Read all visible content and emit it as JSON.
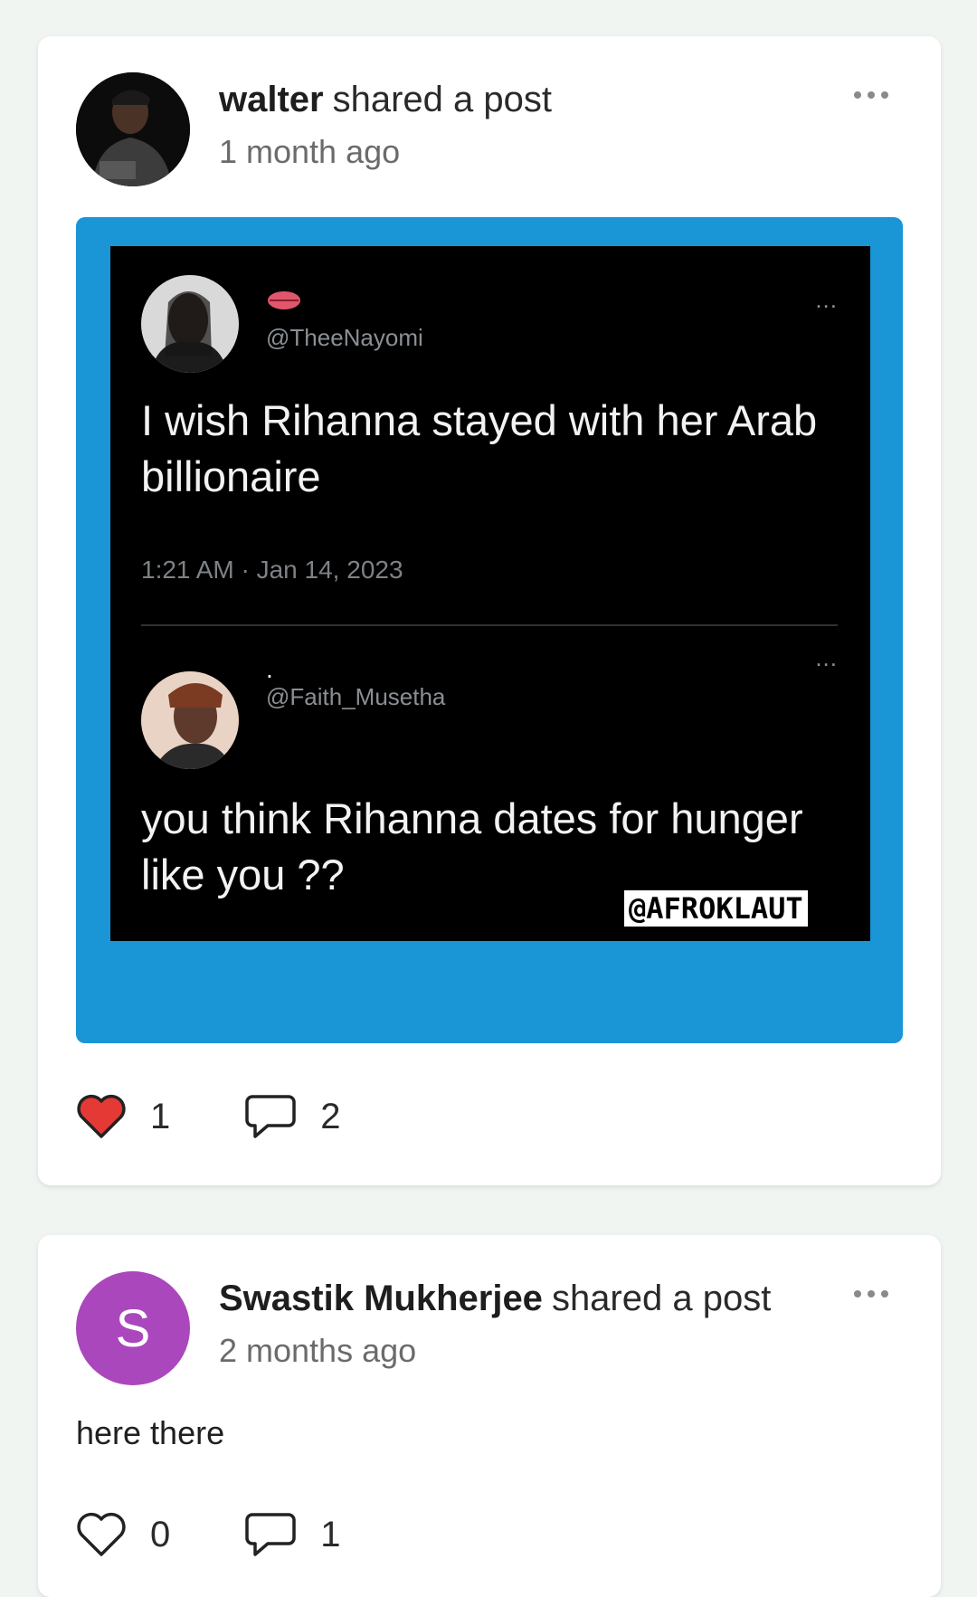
{
  "feed": {
    "posts": [
      {
        "user": "walter",
        "action": "shared a post",
        "time": "1 month ago",
        "media": {
          "tweet1": {
            "handle": "@TheeNayomi",
            "text": "I wish Rihanna stayed with her Arab billionaire",
            "date": "1:21 AM · Jan 14, 2023",
            "more": "..."
          },
          "tweet2": {
            "name": ".",
            "handle": "@Faith_Musetha",
            "text": "you think Rihanna dates for hunger like you ??",
            "more": "..."
          },
          "watermark": "@AFROKLAUT"
        },
        "likes": "1",
        "comments": "2",
        "liked": true
      },
      {
        "user": "Swastik Mukherjee",
        "action": "shared a post",
        "time": "2 months ago",
        "avatar_letter": "S",
        "avatar_color": "#ab47bc",
        "body": "here there",
        "likes": "0",
        "comments": "1",
        "liked": false
      }
    ],
    "icons": {
      "like": "heart-icon",
      "comment": "comment-icon",
      "more": "more-options-icon"
    },
    "colors": {
      "like_active": "#e53935",
      "media_bg": "#1a95d6"
    }
  }
}
